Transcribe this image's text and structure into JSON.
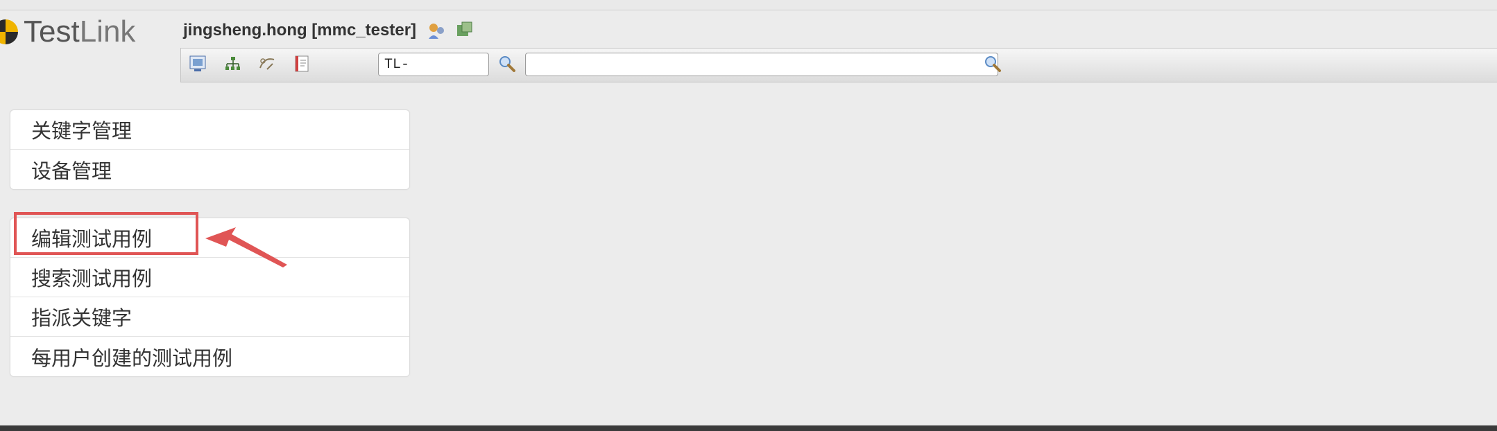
{
  "header": {
    "app_name_a": "Test",
    "app_name_b": "Link",
    "user": "jingsheng.hong [mmc_tester]",
    "icons": [
      "user-settings-icon",
      "logout-icon"
    ]
  },
  "toolbar": {
    "icons": [
      "desktop-icon",
      "project-tree-icon",
      "test-execution-icon",
      "document-icon"
    ],
    "testcase_id_value": "TL-",
    "search_value": "",
    "search_icons": [
      "magnifier-icon",
      "magnifier-icon"
    ]
  },
  "menu_groups": [
    {
      "items": [
        "关键字管理",
        "设备管理"
      ]
    },
    {
      "items": [
        "编辑测试用例",
        "搜索测试用例",
        "指派关键字",
        "每用户创建的测试用例"
      ]
    }
  ],
  "colors": {
    "highlight": "#e05555",
    "arrow": "#e05555"
  }
}
